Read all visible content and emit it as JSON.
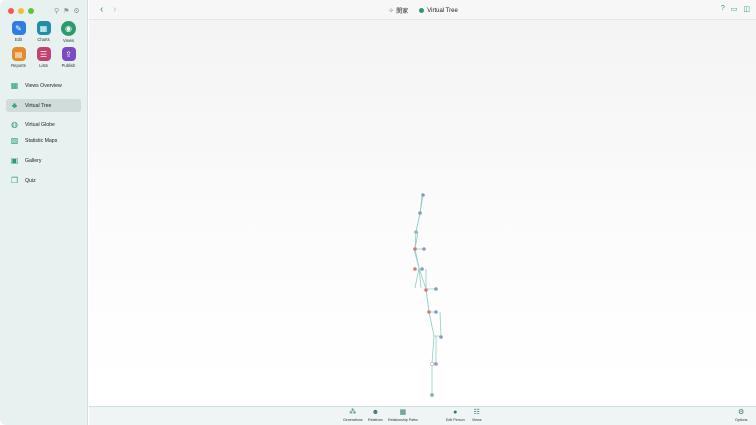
{
  "sidebar": {
    "apps": [
      {
        "label": "Edit",
        "icon": "pencil-icon",
        "glyph": "✎",
        "color": "#2f7de1"
      },
      {
        "label": "Charts",
        "icon": "charts-icon",
        "glyph": "▦",
        "color": "#1f8fa8"
      },
      {
        "label": "Views",
        "icon": "eye-icon",
        "glyph": "◉",
        "color": "#2c9a6f"
      },
      {
        "label": "Reports",
        "icon": "reports-icon",
        "glyph": "▤",
        "color": "#e48a2d"
      },
      {
        "label": "Lists",
        "icon": "lists-icon",
        "glyph": "☰",
        "color": "#c2416f"
      },
      {
        "label": "Publish",
        "icon": "publish-icon",
        "glyph": "⇪",
        "color": "#7a4bc0"
      }
    ],
    "nav": [
      {
        "label": "Views Overview",
        "icon": "grid-icon",
        "glyph": "▦"
      },
      {
        "label": "Virtual Tree",
        "icon": "tree-icon",
        "glyph": "♣"
      },
      {
        "label": "Virtual Globe",
        "icon": "globe-icon",
        "glyph": "◍"
      },
      {
        "label": "Statistic Maps",
        "icon": "map-icon",
        "glyph": "▨"
      },
      {
        "label": "Gallery",
        "icon": "gallery-icon",
        "glyph": "▣"
      },
      {
        "label": "Quiz",
        "icon": "quiz-icon",
        "glyph": "❐"
      }
    ]
  },
  "toolbar": {
    "crumb": "閔家",
    "title": "Virtual Tree"
  },
  "bottom_bar": [
    {
      "label": "Generations",
      "icon": "generations-icon",
      "glyph": "⁂"
    },
    {
      "label": "Relatives",
      "icon": "relatives-icon",
      "glyph": "☻"
    },
    {
      "label": "Relationship Paths",
      "icon": "relationship-paths-icon",
      "glyph": "▦"
    },
    {
      "label": "Edit Person",
      "icon": "edit-person-icon",
      "glyph": "●"
    },
    {
      "label": "Views",
      "icon": "views-icon",
      "glyph": "☷"
    },
    {
      "label": "Options",
      "icon": "options-icon",
      "glyph": "⚙"
    }
  ],
  "colors": {
    "accent": "#2c9a6f",
    "male": "#8a9db5",
    "female": "#d47b78"
  }
}
